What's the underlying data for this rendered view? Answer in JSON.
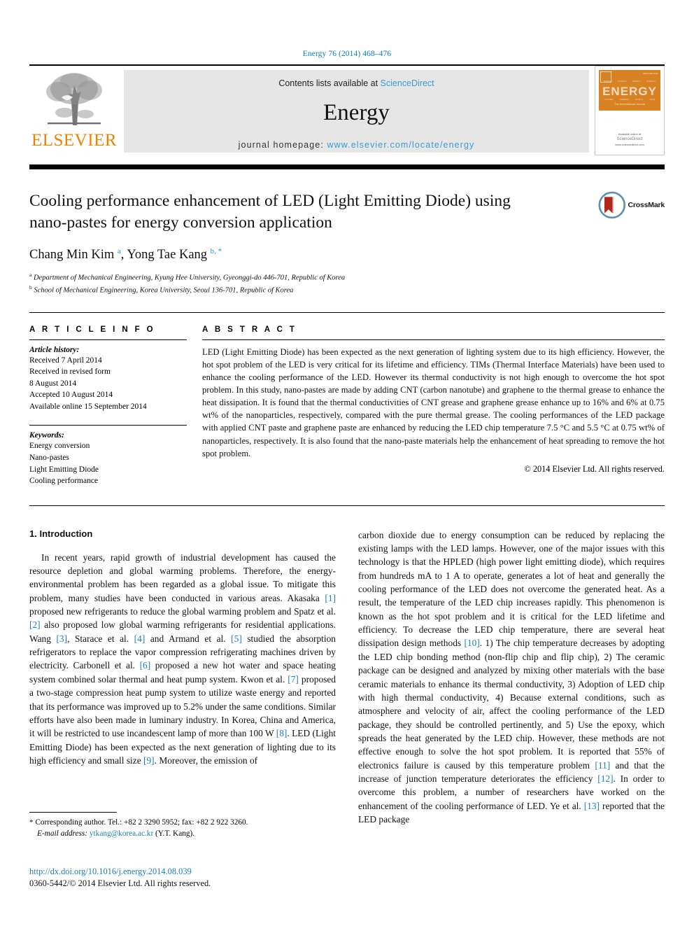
{
  "running_head": "Energy 76 (2014) 468–476",
  "masthead": {
    "publisher_wordmark": "ELSEVIER",
    "contents_prefix": "Contents lists available at ",
    "contents_link": "ScienceDirect",
    "journal_name": "Energy",
    "homepage_prefix": "journal homepage: ",
    "homepage_url": "www.elsevier.com/locate/energy",
    "cover": {
      "title": "ENERGY",
      "subtitle": "The International Journal",
      "issn": "ISSN 0360-5442",
      "top_labels": [
        "ENERGY",
        "ENERGY",
        "ENERGY",
        "ENERGY"
      ],
      "row2_labels": [
        "VOLUME",
        "NUMBER",
        "MONTH",
        "YEAR"
      ],
      "bottom_note": "Available online at",
      "bottom_brand": "ScienceDirect",
      "bottom_url": "www.sciencedirect.com"
    },
    "accent_orange": "#f08000",
    "link_blue": "#3a9bd4"
  },
  "article": {
    "title": "Cooling performance enhancement of LED (Light Emitting Diode) using nano-pastes for energy conversion application",
    "crossmark_label": "CrossMark",
    "authors_html": "Chang Min Kim <sup>a</sup>, Yong Tae Kang <sup>b, *</sup>",
    "affiliations": [
      {
        "marker": "a",
        "text": "Department of Mechanical Engineering, Kyung Hee University, Gyeonggi-do 446-701, Republic of Korea"
      },
      {
        "marker": "b",
        "text": "School of Mechanical Engineering, Korea University, Seoul 136-701, Republic of Korea"
      }
    ]
  },
  "article_info": {
    "heading": "A R T I C L E   I N F O",
    "history_label": "Article history:",
    "history": [
      "Received 7 April 2014",
      "Received in revised form",
      "8 August 2014",
      "Accepted 10 August 2014",
      "Available online 15 September 2014"
    ],
    "keywords_label": "Keywords:",
    "keywords": [
      "Energy conversion",
      "Nano-pastes",
      "Light Emitting Diode",
      "Cooling performance"
    ]
  },
  "abstract": {
    "heading": "A B S T R A C T",
    "text": "LED (Light Emitting Diode) has been expected as the next generation of lighting system due to its high efficiency. However, the hot spot problem of the LED is very critical for its lifetime and efficiency. TIMs (Thermal Interface Materials) have been used to enhance the cooling performance of the LED. However its thermal conductivity is not high enough to overcome the hot spot problem. In this study, nano-pastes are made by adding CNT (carbon nanotube) and graphene to the thermal grease to enhance the heat dissipation. It is found that the thermal conductivities of CNT grease and graphene grease enhance up to 16% and 6% at 0.75 wt% of the nanoparticles, respectively, compared with the pure thermal grease. The cooling performances of the LED package with applied CNT paste and graphene paste are enhanced by reducing the LED chip temperature 7.5 °C and 5.5 °C at 0.75 wt% of nanoparticles, respectively. It is also found that the nano-paste materials help the enhancement of heat spreading to remove the hot spot problem.",
    "copyright": "© 2014 Elsevier Ltd. All rights reserved."
  },
  "body": {
    "section_number_title": "1. Introduction",
    "left_paragraph_html": "In recent years, rapid growth of industrial development has caused the resource depletion and global warming problems. Therefore, the energy-environmental problem has been regarded as a global issue. To mitigate this problem, many studies have been conducted in various areas. Akasaka <span class=\"ref\">[1]</span> proposed new refrigerants to reduce the global warming problem and Spatz et al. <span class=\"ref\">[2]</span> also proposed low global warming refrigerants for residential applications. Wang <span class=\"ref\">[3]</span>, Starace et al. <span class=\"ref\">[4]</span> and Armand et al. <span class=\"ref\">[5]</span> studied the absorption refrigerators to replace the vapor compression refrigerating machines driven by electricity. Carbonell et al. <span class=\"ref\">[6]</span> proposed a new hot water and space heating system combined solar thermal and heat pump system. Kwon et al. <span class=\"ref\">[7]</span> proposed a two-stage compression heat pump system to utilize waste energy and reported that its performance was improved up to 5.2% under the same conditions. Similar efforts have also been made in luminary industry. In Korea, China and America, it will be restricted to use incandescent lamp of more than 100 W <span class=\"ref\">[8]</span>. LED (Light Emitting Diode) has been expected as the next generation of lighting due to its high efficiency and small size <span class=\"ref\">[9]</span>. Moreover, the emission of",
    "right_paragraph_html": "carbon dioxide due to energy consumption can be reduced by replacing the existing lamps with the LED lamps. However, one of the major issues with this technology is that the HPLED (high power light emitting diode), which requires from hundreds mA to 1 A to operate, generates a lot of heat and generally the cooling performance of the LED does not overcome the generated heat. As a result, the temperature of the LED chip increases rapidly. This phenomenon is known as the hot spot problem and it is critical for the LED lifetime and efficiency. To decrease the LED chip temperature, there are several heat dissipation design methods <span class=\"ref\">[10]</span>. 1) The chip temperature decreases by adopting the LED chip bonding method (non-flip chip and flip chip), 2) The ceramic package can be designed and analyzed by mixing other materials with the base ceramic materials to enhance its thermal conductivity, 3) Adoption of LED chip with high thermal conductivity, 4) Because external conditions, such as atmosphere and velocity of air, affect the cooling performance of the LED package, they should be controlled pertinently, and 5) Use the epoxy, which spreads the heat generated by the LED chip. However, these methods are not effective enough to solve the hot spot problem. It is reported that 55% of electronics failure is caused by this temperature problem <span class=\"ref\">[11]</span> and that the increase of junction temperature deteriorates the efficiency <span class=\"ref\">[12]</span>. In order to overcome this problem, a number of researchers have worked on the enhancement of the cooling performance of LED. Ye et al. <span class=\"ref\">[13]</span> reported that the LED package"
  },
  "footnote_html": "<span class=\"star\">*</span> Corresponding author. Tel.: +82 2 3290 5952; fax: +82 2 922 3260.<br><i>E-mail address:</i> <span class=\"fn-link\">ytkang@korea.ac.kr</span> (Y.T. Kang).",
  "footer": {
    "doi": "http://dx.doi.org/10.1016/j.energy.2014.08.039",
    "issn_line": "0360-5442/© 2014 Elsevier Ltd. All rights reserved."
  }
}
